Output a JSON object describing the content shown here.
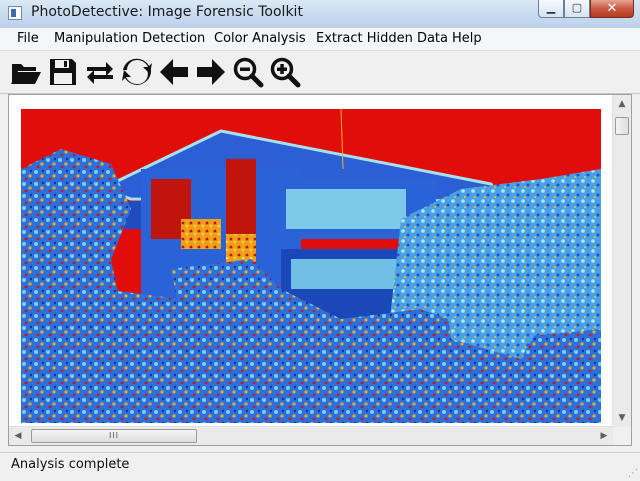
{
  "window": {
    "title": "PhotoDetective: Image Forensic Toolkit"
  },
  "menu": [
    "File",
    "Manipulation Detection",
    "Color Analysis",
    "Extract Hidden Data",
    "Help"
  ],
  "toolbar": [
    {
      "icon": "open-folder-icon"
    },
    {
      "icon": "save-icon"
    },
    {
      "icon": "swap-icon"
    },
    {
      "icon": "refresh-icon"
    },
    {
      "icon": "arrow-left-icon"
    },
    {
      "icon": "arrow-right-icon"
    },
    {
      "icon": "zoom-out-icon"
    },
    {
      "icon": "zoom-in-icon"
    }
  ],
  "image": {
    "description_colors": {
      "sky": "#e00d0a",
      "house": "#2a63d8",
      "foliage": "#3b7be0",
      "hot": "#f2b21c"
    }
  },
  "scrollbar": {
    "h_thumb_glyph": "III"
  },
  "status": {
    "text": "Analysis complete"
  }
}
